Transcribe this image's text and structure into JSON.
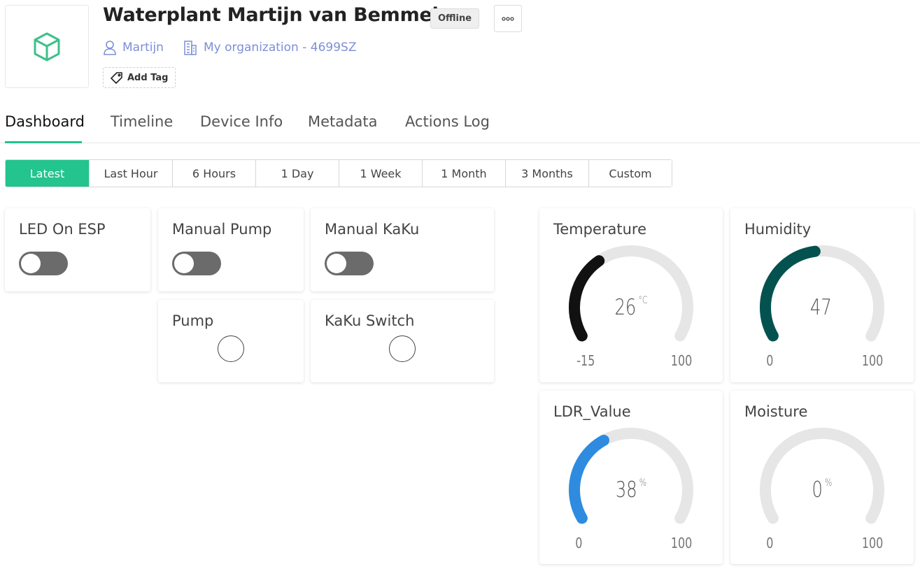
{
  "device": {
    "title": "Waterplant Martijn van Bemmel",
    "status": "Offline",
    "owner": "Martijn",
    "organization": "My organization - 4699SZ",
    "add_tag_label": "Add Tag",
    "icon": "cube-icon"
  },
  "tabs": [
    {
      "label": "Dashboard",
      "active": true
    },
    {
      "label": "Timeline",
      "active": false
    },
    {
      "label": "Device Info",
      "active": false
    },
    {
      "label": "Metadata",
      "active": false
    },
    {
      "label": "Actions Log",
      "active": false
    }
  ],
  "time_ranges": [
    {
      "label": "Latest",
      "active": true
    },
    {
      "label": "Last Hour",
      "active": false
    },
    {
      "label": "6 Hours",
      "active": false
    },
    {
      "label": "1 Day",
      "active": false
    },
    {
      "label": "1 Week",
      "active": false
    },
    {
      "label": "1 Month",
      "active": false
    },
    {
      "label": "3 Months",
      "active": false
    },
    {
      "label": "Custom",
      "active": false
    }
  ],
  "switches": [
    {
      "title": "LED On ESP",
      "on": false
    },
    {
      "title": "Manual Pump",
      "on": false
    },
    {
      "title": "Manual KaKu",
      "on": false
    }
  ],
  "leds": [
    {
      "title": "Pump",
      "on": false
    },
    {
      "title": "KaKu Switch",
      "on": false
    }
  ],
  "gauges": [
    {
      "title": "Temperature",
      "value": "26",
      "unit": "°C",
      "min": "-15",
      "max": "100",
      "color": "#111111"
    },
    {
      "title": "Humidity",
      "value": "47",
      "unit": "",
      "min": "0",
      "max": "100",
      "color": "#04524f"
    },
    {
      "title": "LDR_Value",
      "value": "38",
      "unit": "%",
      "min": "0",
      "max": "100",
      "color": "#2e8be0"
    },
    {
      "title": "Moisture",
      "value": "0",
      "unit": "%",
      "min": "0",
      "max": "100",
      "color": "#2e8be0"
    }
  ],
  "colors": {
    "accent": "#23c48e",
    "link": "#7d8fd6",
    "track": "#e6e6e6"
  }
}
